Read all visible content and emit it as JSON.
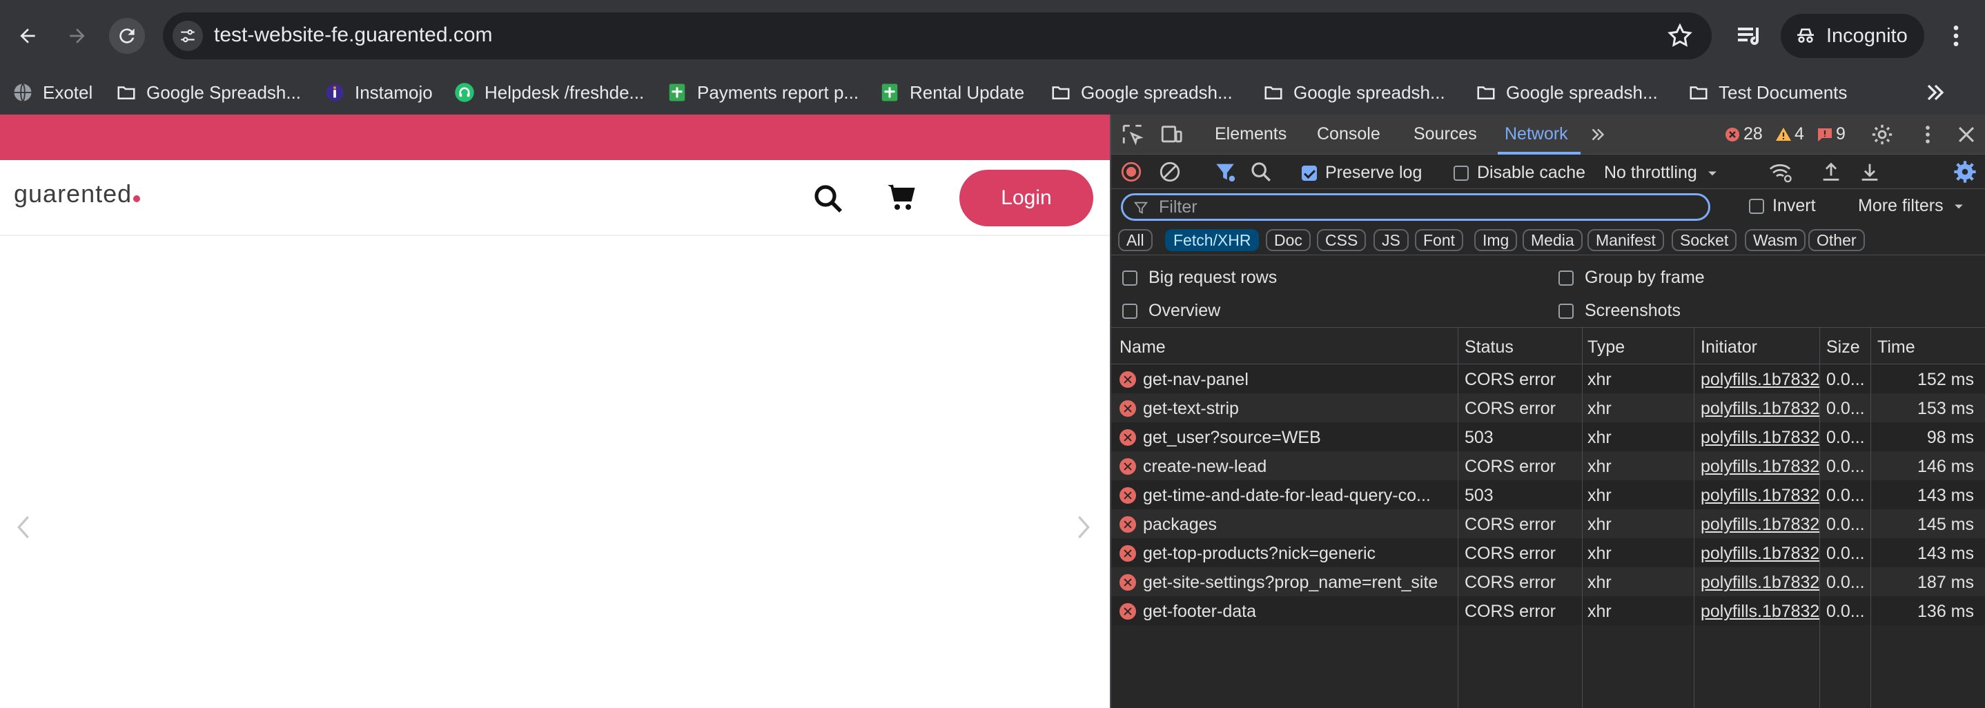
{
  "browser": {
    "url": "test-website-fe.guarented.com",
    "incognito_label": "Incognito",
    "bookmarks": [
      {
        "label": "Exotel",
        "icon": "globe-icon"
      },
      {
        "label": "Google Spreadsh...",
        "icon": "folder-icon"
      },
      {
        "label": "Instamojo",
        "icon": "instamojo-icon"
      },
      {
        "label": "Helpdesk /freshde...",
        "icon": "headset-icon"
      },
      {
        "label": "Payments report p...",
        "icon": "sheets-icon"
      },
      {
        "label": "Rental Update",
        "icon": "sheets-icon"
      },
      {
        "label": "Google spreadsh...",
        "icon": "folder-icon"
      },
      {
        "label": "Google spreadsh...",
        "icon": "folder-icon"
      },
      {
        "label": "Google spreadsh...",
        "icon": "folder-icon"
      },
      {
        "label": "Test Documents",
        "icon": "folder-icon"
      }
    ]
  },
  "site": {
    "logo": "guarented",
    "login_label": "Login",
    "accent_color": "#d93f63"
  },
  "devtools": {
    "tabs": [
      "Elements",
      "Console",
      "Sources",
      "Network"
    ],
    "active_tab": "Network",
    "errors": "28",
    "warnings": "4",
    "issues": "9",
    "toolbar": {
      "preserve_log": "Preserve log",
      "disable_cache": "Disable cache",
      "throttling": "No throttling"
    },
    "filter_placeholder": "Filter",
    "invert_label": "Invert",
    "more_filters": "More filters",
    "type_filters": [
      "All",
      "Fetch/XHR",
      "Doc",
      "CSS",
      "JS",
      "Font",
      "Img",
      "Media",
      "Manifest",
      "Socket",
      "Wasm",
      "Other"
    ],
    "active_type_filter": "Fetch/XHR",
    "options": {
      "big_request_rows": "Big request rows",
      "group_by_frame": "Group by frame",
      "overview": "Overview",
      "screenshots": "Screenshots"
    },
    "columns": [
      "Name",
      "Status",
      "Type",
      "Initiator",
      "Size",
      "Time"
    ],
    "requests": [
      {
        "name": "get-nav-panel",
        "status": "CORS error",
        "type": "xhr",
        "initiator": "polyfills.1b7832",
        "size": "0.0...",
        "time": "152 ms"
      },
      {
        "name": "get-text-strip",
        "status": "CORS error",
        "type": "xhr",
        "initiator": "polyfills.1b7832",
        "size": "0.0...",
        "time": "153 ms"
      },
      {
        "name": "get_user?source=WEB",
        "status": "503",
        "type": "xhr",
        "initiator": "polyfills.1b7832",
        "size": "0.0...",
        "time": "98 ms"
      },
      {
        "name": "create-new-lead",
        "status": "CORS error",
        "type": "xhr",
        "initiator": "polyfills.1b7832",
        "size": "0.0...",
        "time": "146 ms"
      },
      {
        "name": "get-time-and-date-for-lead-query-co...",
        "status": "503",
        "type": "xhr",
        "initiator": "polyfills.1b7832",
        "size": "0.0...",
        "time": "143 ms"
      },
      {
        "name": "packages",
        "status": "CORS error",
        "type": "xhr",
        "initiator": "polyfills.1b7832",
        "size": "0.0...",
        "time": "145 ms"
      },
      {
        "name": "get-top-products?nick=generic",
        "status": "CORS error",
        "type": "xhr",
        "initiator": "polyfills.1b7832",
        "size": "0.0...",
        "time": "143 ms"
      },
      {
        "name": "get-site-settings?prop_name=rent_site",
        "status": "CORS error",
        "type": "xhr",
        "initiator": "polyfills.1b7832",
        "size": "0.0...",
        "time": "187 ms"
      },
      {
        "name": "get-footer-data",
        "status": "CORS error",
        "type": "xhr",
        "initiator": "polyfills.1b7832",
        "size": "0.0...",
        "time": "136 ms"
      }
    ]
  }
}
